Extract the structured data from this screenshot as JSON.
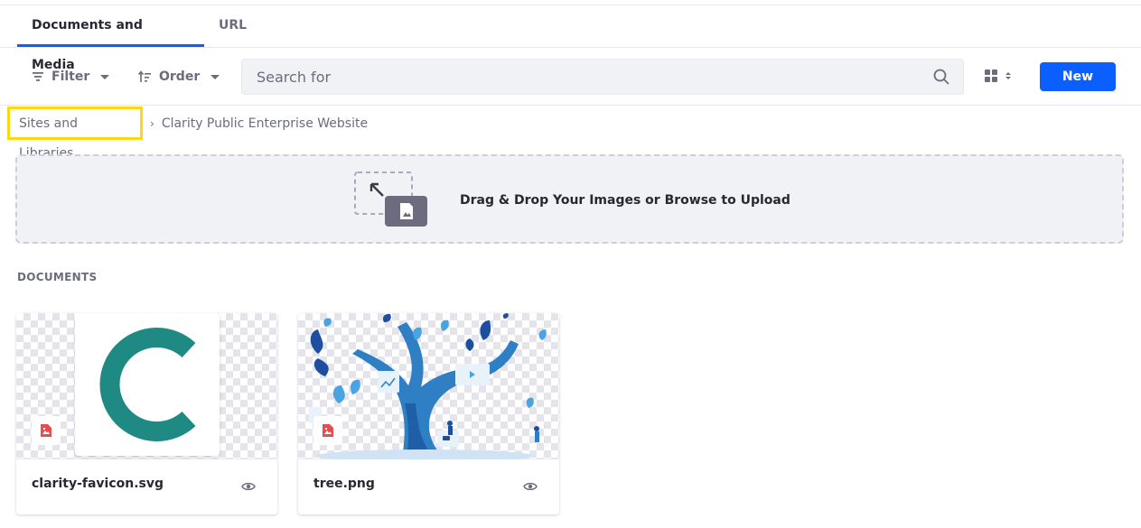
{
  "tabs": [
    {
      "label": "Documents and Media",
      "active": true
    },
    {
      "label": "URL",
      "active": false
    }
  ],
  "toolbar": {
    "filter_label": "Filter",
    "order_label": "Order",
    "search_placeholder": "Search for",
    "new_label": "New"
  },
  "breadcrumb": {
    "items": [
      "Sites and Libraries",
      "Clarity Public Enterprise Website"
    ]
  },
  "dropzone": {
    "text": "Drag & Drop Your Images or Browse to Upload"
  },
  "documents": {
    "section_title": "DOCUMENTS",
    "items": [
      {
        "name": "clarity-favicon.svg",
        "icon": "image-file-icon"
      },
      {
        "name": "tree.png",
        "icon": "image-file-icon"
      }
    ]
  },
  "colors": {
    "accent": "#0b5fff",
    "highlight": "#ffd814",
    "favicon": "#1f8a84",
    "tree": "#2e8bd6"
  }
}
